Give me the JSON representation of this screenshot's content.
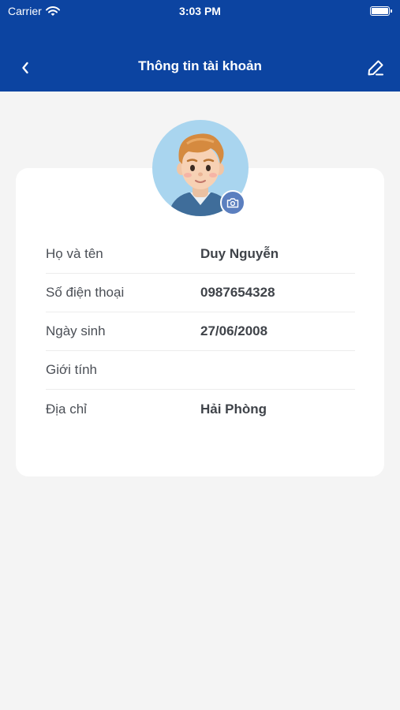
{
  "status_bar": {
    "carrier": "Carrier",
    "time": "3:03 PM"
  },
  "header": {
    "title": "Thông tin tài khoản",
    "back_icon": "chevron-left-icon",
    "edit_icon": "pencil-icon",
    "background_color": "#0c44a1"
  },
  "profile": {
    "avatar": "avatar-illustration",
    "camera_icon": "camera-icon",
    "fields": [
      {
        "label": "Họ và tên",
        "value": "Duy Nguyễn"
      },
      {
        "label": "Số điện thoại",
        "value": "0987654328"
      },
      {
        "label": "Ngày sinh",
        "value": "27/06/2008"
      },
      {
        "label": "Giới tính",
        "value": ""
      },
      {
        "label": "Địa chỉ",
        "value": "Hải Phòng"
      }
    ]
  }
}
